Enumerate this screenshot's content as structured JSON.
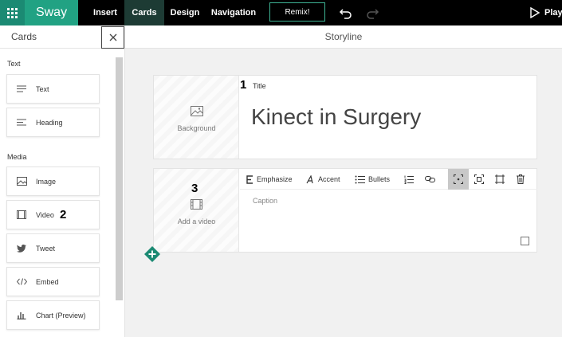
{
  "topbar": {
    "brand": "Sway",
    "tabs": [
      {
        "label": "Insert"
      },
      {
        "label": "Cards"
      },
      {
        "label": "Design"
      },
      {
        "label": "Navigation"
      }
    ],
    "remix_label": "Remix!",
    "play_label": "Play"
  },
  "left_panel": {
    "title": "Cards",
    "sections": {
      "text": "Text",
      "media": "Media"
    },
    "items": [
      {
        "label": "Text",
        "icon": "text-lines-icon"
      },
      {
        "label": "Heading",
        "icon": "heading-icon"
      },
      {
        "label": "Image",
        "icon": "image-icon"
      },
      {
        "label": "Video",
        "icon": "video-icon"
      },
      {
        "label": "Tweet",
        "icon": "twitter-icon"
      },
      {
        "label": "Embed",
        "icon": "code-icon"
      },
      {
        "label": "Chart (Preview)",
        "icon": "chart-icon"
      }
    ]
  },
  "storyline": {
    "title": "Storyline",
    "title_card": {
      "label": "Title",
      "text": "Kinect in Surgery",
      "media_label": "Background"
    },
    "video_card": {
      "media_label": "Add a video",
      "caption_placeholder": "Caption",
      "toolbar": {
        "emphasize": "Emphasize",
        "accent": "Accent",
        "bullets": "Bullets"
      }
    }
  },
  "markers": {
    "one": "1",
    "two": "2",
    "three": "3"
  },
  "colors": {
    "brand_dark": "#1b8a73",
    "brand": "#21a283",
    "active_tab": "#1d3b34",
    "add_button": "#1b8a73"
  }
}
